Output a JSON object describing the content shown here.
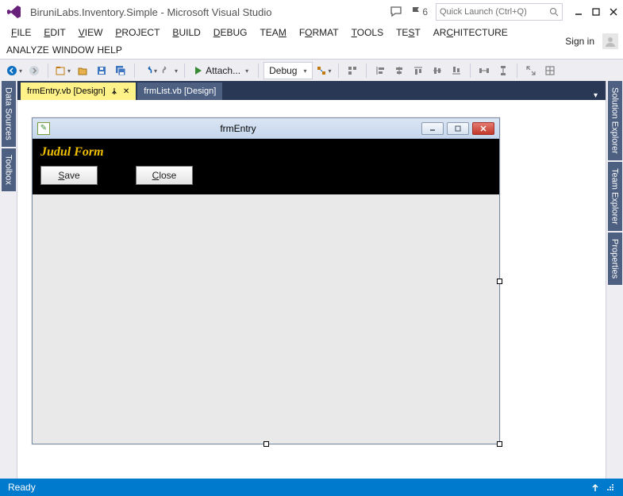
{
  "titlebar": {
    "title": "BiruniLabs.Inventory.Simple - Microsoft Visual Studio",
    "flag_count": "6",
    "quicklaunch_placeholder": "Quick Launch (Ctrl+Q)",
    "signin": "Sign in"
  },
  "menu": {
    "file": "FILE",
    "edit": "EDIT",
    "view": "VIEW",
    "project": "PROJECT",
    "build": "BUILD",
    "debug": "DEBUG",
    "team": "TEAM",
    "format": "FORMAT",
    "tools": "TOOLS",
    "test": "TEST",
    "architecture": "ARCHITECTURE",
    "analyze": "ANALYZE",
    "window": "WINDOW",
    "help": "HELP"
  },
  "toolbar": {
    "attach": "Attach...",
    "config": "Debug"
  },
  "left_tabs": {
    "data_sources": "Data Sources",
    "toolbox": "Toolbox"
  },
  "right_tabs": {
    "solution_explorer": "Solution Explorer",
    "team_explorer": "Team Explorer",
    "properties": "Properties"
  },
  "doc_tabs": {
    "active": "frmEntry.vb [Design]",
    "inactive": "frmList.vb [Design]"
  },
  "form": {
    "title": "frmEntry",
    "label": "Judul Form",
    "save": "Save",
    "close": "Close"
  },
  "status": {
    "ready": "Ready"
  }
}
